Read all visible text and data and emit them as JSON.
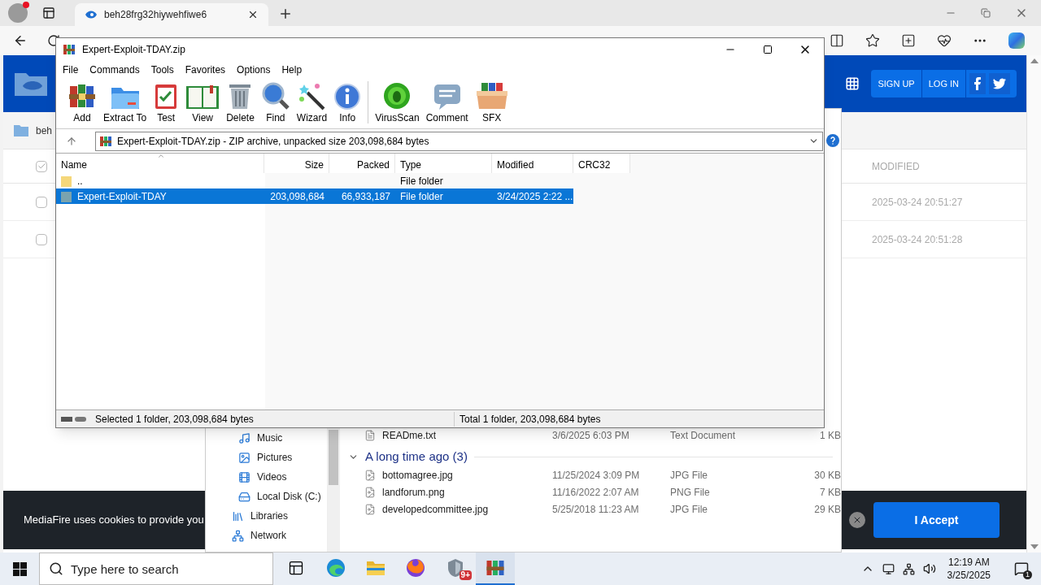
{
  "browser": {
    "tabs": [
      {
        "title": "beh28frg32hiywehfiwe6",
        "selected": true
      }
    ]
  },
  "site": {
    "nav": [
      "SIGN UP",
      "LOG IN"
    ],
    "breadcrumb": "beh",
    "table": {
      "header_checked": true,
      "column": "MODIFIED",
      "rows": [
        {
          "checked": false,
          "modified": "2025-03-24 20:51:27"
        },
        {
          "checked": false,
          "modified": "2025-03-24 20:51:28"
        }
      ]
    },
    "cookie_banner": {
      "text": "MediaFire uses cookies to provide you",
      "button": "I Accept"
    }
  },
  "explorer": {
    "nav": [
      {
        "label": "Music",
        "indent": true
      },
      {
        "label": "Pictures",
        "indent": true
      },
      {
        "label": "Videos",
        "indent": true
      },
      {
        "label": "Local Disk (C:)",
        "indent": true
      },
      {
        "label": "Libraries",
        "indent": false
      },
      {
        "label": "Network",
        "indent": false
      }
    ],
    "files": [
      {
        "name": "READme.txt",
        "modified": "3/6/2025 6:03 PM",
        "type": "Text Document",
        "size": "1 KB"
      }
    ],
    "group": {
      "label": "A long time ago (3)",
      "expanded": true,
      "files": [
        {
          "name": "bottomagree.jpg",
          "modified": "11/25/2024 3:09 PM",
          "type": "JPG File",
          "size": "30 KB"
        },
        {
          "name": "landforum.png",
          "modified": "11/16/2022 2:07 AM",
          "type": "PNG File",
          "size": "7 KB"
        },
        {
          "name": "developedcommittee.jpg",
          "modified": "5/25/2018 11:23 AM",
          "type": "JPG File",
          "size": "29 KB"
        }
      ]
    }
  },
  "winrar": {
    "title": "Expert-Exploit-TDAY.zip",
    "menu": [
      "File",
      "Commands",
      "Tools",
      "Favorites",
      "Options",
      "Help"
    ],
    "toolbar": [
      "Add",
      "Extract To",
      "Test",
      "View",
      "Delete",
      "Find",
      "Wizard",
      "Info",
      "VirusScan",
      "Comment",
      "SFX"
    ],
    "path": "Expert-Exploit-TDAY.zip - ZIP archive, unpacked size 203,098,684 bytes",
    "columns": [
      "Name",
      "Size",
      "Packed",
      "Type",
      "Modified",
      "CRC32"
    ],
    "rows": [
      {
        "kind": "parent",
        "name": "..",
        "type": "File folder",
        "selected": false
      },
      {
        "kind": "folder",
        "name": "Expert-Exploit-TDAY",
        "size": "203,098,684",
        "packed": "66,933,187",
        "type": "File folder",
        "modified": "3/24/2025 2:22 ...",
        "selected": true
      }
    ],
    "status_left": "Selected 1 folder, 203,098,684 bytes",
    "status_right": "Total 1 folder, 203,098,684 bytes"
  },
  "taskbar": {
    "search_placeholder": "Type here to search",
    "apps": [
      {
        "selected": false
      },
      {
        "selected": false
      },
      {
        "selected": false
      },
      {
        "selected": false
      },
      {
        "selected": false,
        "badge": "9+"
      },
      {
        "selected": true
      }
    ],
    "time": "12:19 AM",
    "date": "3/25/2025",
    "notifications": "1"
  }
}
